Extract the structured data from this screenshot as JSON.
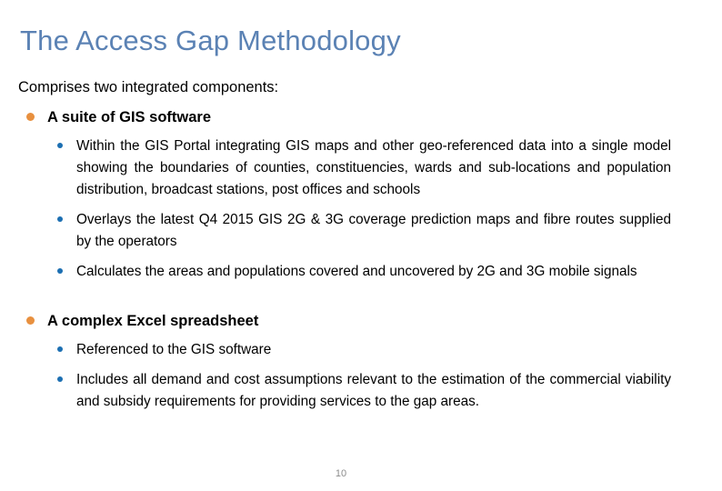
{
  "slide": {
    "title": "The Access Gap Methodology",
    "lead_line": "Comprises two integrated components:",
    "slide_number": "10",
    "colors": {
      "title": "#5b82b4",
      "level1_bullet": "#e8903f",
      "level2_bullet": "#1c6fb2",
      "body_text": "#000000",
      "slide_number": "#8c8c8c",
      "background": "#ffffff"
    },
    "sections": [
      {
        "heading": "A suite of GIS software",
        "items": [
          "Within the GIS Portal integrating GIS maps and other geo-referenced data into a single model showing the boundaries of counties, constituencies, wards and sub-locations and population distribution, broadcast stations, post offices and schools",
          "Overlays the latest Q4 2015 GIS 2G & 3G coverage prediction maps and fibre routes supplied by the operators",
          "Calculates the areas and populations covered and uncovered by 2G and 3G mobile signals"
        ]
      },
      {
        "heading": "A complex Excel spreadsheet",
        "items": [
          "Referenced to the GIS software",
          "Includes all demand and cost assumptions relevant to the estimation of the commercial viability and subsidy requirements for providing services to the gap areas."
        ]
      }
    ]
  }
}
